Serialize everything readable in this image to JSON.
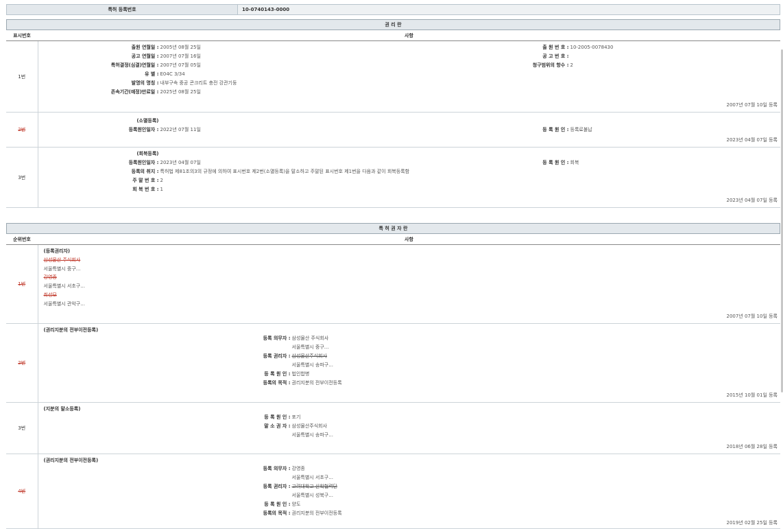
{
  "patent": {
    "label": "특허 등록번호",
    "number": "10-0740143-0000"
  },
  "rights_section": {
    "title": "권 리 란",
    "col_no": "표시번호",
    "col_item": "사항",
    "rows": [
      {
        "no": "1번",
        "left": [
          {
            "k": "출원 연월일 :",
            "v": "2005년 08월 25일"
          },
          {
            "k": "공고 연월일 :",
            "v": "2007년 07월 16일"
          },
          {
            "k": "특허결정(심결)연월일 :",
            "v": "2007년 07월 05일"
          },
          {
            "k": "유 별 :",
            "v": "E04C 3/34"
          },
          {
            "k": "발명의 명칭 :",
            "v": "내부구속 중공 콘크리트 충전 강관기둥"
          },
          {
            "k": "존속기간(예정)만료일 :",
            "v": "2025년 08월 25일"
          }
        ],
        "right": [
          {
            "k": "출 원 번 호 :",
            "v": "10-2005-0078430"
          },
          {
            "k": "공 고 번 호 :",
            "v": ""
          },
          {
            "k": "청구범위의 항수 :",
            "v": "2"
          }
        ],
        "date": "2007년 07월 10일 등록"
      },
      {
        "no": "2번",
        "heading": "(소멸등록)",
        "left": [
          {
            "k": "등록원인일자 :",
            "v": "2022년 07월 11일"
          }
        ],
        "right": [
          {
            "k": "등 록 원 인 :",
            "v": "등록료불납"
          }
        ],
        "date": "2023년 04월 07일 등록"
      },
      {
        "no": "3번",
        "heading": "(회복등록)",
        "left": [
          {
            "k": "등록원인일자 :",
            "v": "2023년 04월 07일"
          },
          {
            "k": "등록의 취지 :",
            "v": "특허법 제81조의3의 규정에 의하여 표시번호 제2번(소멸등록)을 말소하고 주말된 표시번호 제1번을 다음과 같이 회복등록함"
          },
          {
            "k": "주 말 번 호 :",
            "v": "2"
          },
          {
            "k": "회 복 번 호 :",
            "v": "1"
          }
        ],
        "right": [
          {
            "k": "등 록 원 인 :",
            "v": "회복"
          }
        ],
        "date": "2023년 04월 07일 등록"
      }
    ]
  },
  "holder_section": {
    "title": "특 허 권 자 란",
    "col_no": "순위번호",
    "col_item": "사항",
    "rows": [
      {
        "no": "1번",
        "heading": "(등록권리자)",
        "lines": [
          {
            "t": "삼성물산 주식회사"
          },
          {
            "t": "서울특별시 중구..."
          },
          {
            "t": "강영종"
          },
          {
            "t": "서울특별시 서초구..."
          },
          {
            "t": "최성모"
          },
          {
            "t": "서울특별시 관악구..."
          }
        ],
        "date": "2007년 07월 10일 등록"
      },
      {
        "no": "2번",
        "heading": "(권리지분의 전부이전등록)",
        "pairs": [
          {
            "k": "등록 의무자 :",
            "v": "삼성물산 주식회사"
          },
          {
            "k": "",
            "v": "서울특별시 중구..."
          },
          {
            "k": "등록 권리자 :",
            "v": "삼성물산주식회사"
          },
          {
            "k": "",
            "v": "서울특별시 송파구..."
          },
          {
            "k": "등 록 원 인 :",
            "v": "법인합병"
          },
          {
            "k": "등록의 목적 :",
            "v": "권리지분의 전부이전등록"
          }
        ],
        "date": "2015년 10월 01일 등록"
      },
      {
        "no": "3번",
        "heading": "(지분의 말소등록)",
        "pairs": [
          {
            "k": "등 록 원 인 :",
            "v": "포기"
          },
          {
            "k": "말 소 권 자 :",
            "v": "삼성물산주식회사"
          },
          {
            "k": "",
            "v": "서울특별시 송파구..."
          }
        ],
        "date": "2018년 06월 28일 등록"
      },
      {
        "no": "4번",
        "heading": "(권리지분의 전부이전등록)",
        "pairs": [
          {
            "k": "등록 의무자 :",
            "v": "강영종"
          },
          {
            "k": "",
            "v": "서울특별시 서초구..."
          },
          {
            "k": "등록 권리자 :",
            "v": "고려대학교 산학협력단"
          },
          {
            "k": "",
            "v": "서울특별시 성북구..."
          },
          {
            "k": "등 록 원 인 :",
            "v": "양도"
          },
          {
            "k": "등록의 목적 :",
            "v": "권리지분의 전부이전등록"
          }
        ],
        "date": "2019년 02월 25일 등록"
      }
    ]
  }
}
